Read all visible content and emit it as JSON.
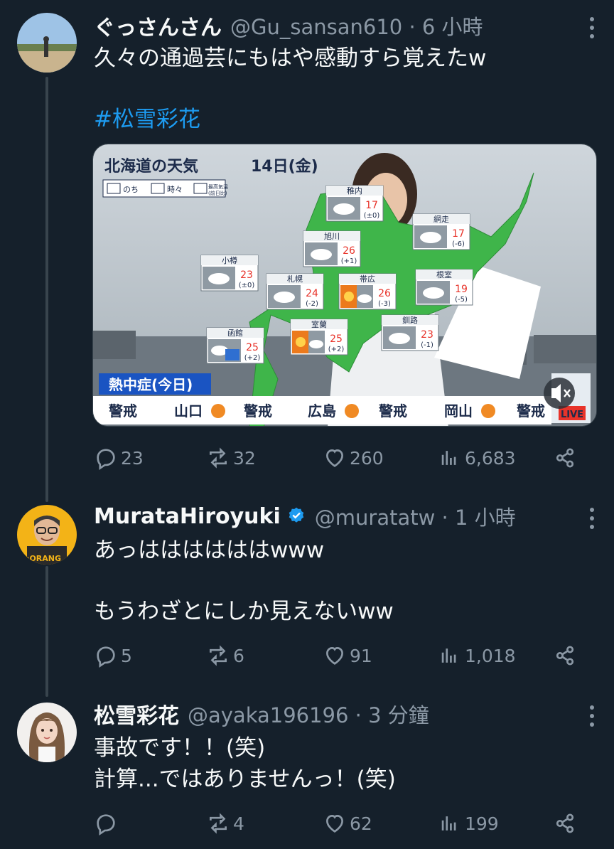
{
  "tweets": [
    {
      "name": "ぐっさんさん",
      "handle": "@Gu_sansan610 · 6 小時",
      "lines": [
        "久々の通過芸にもはや感動すら覚えたw",
        "",
        "#松雪彩花"
      ],
      "reply_count": "23",
      "retweet_count": "32",
      "like_count": "260",
      "view_count": "6,683"
    },
    {
      "name": "MurataHiroyuki",
      "handle": "@muratatw · 1 小時",
      "lines": [
        "あっははははははwww",
        "",
        "もうわざとにしか見えないww"
      ],
      "avatar_text": "eORANG",
      "reply_count": "5",
      "retweet_count": "6",
      "like_count": "91",
      "view_count": "1,018"
    },
    {
      "name": "松雪彩花",
      "handle": "@ayaka196196 · 3 分鐘",
      "lines": [
        "事故です！！(笑)",
        "計算...ではありませんっ！(笑)"
      ],
      "reply_count": "",
      "retweet_count": "4",
      "like_count": "62",
      "view_count": "199"
    }
  ],
  "weather": {
    "title": "北海道の天気",
    "date": "14日(金)",
    "legend_nochi": "のち",
    "legend_tokidoki": "時々",
    "legend_max_temp": "最高気温",
    "legend_vs_prev": "(前日比)",
    "heat_label": "熱中症(今日)",
    "ticker": [
      "警戒",
      "山口",
      "警戒",
      "広島",
      "警戒",
      "岡山",
      "警戒"
    ],
    "live_text": "LIVE",
    "cities": [
      {
        "name": "稚内",
        "temp": "17",
        "diff": "(±0)"
      },
      {
        "name": "網走",
        "temp": "17",
        "diff": "(-6)"
      },
      {
        "name": "旭川",
        "temp": "26",
        "diff": "(+1)"
      },
      {
        "name": "小樽",
        "temp": "23",
        "diff": "(±0)"
      },
      {
        "name": "札幌",
        "temp": "24",
        "diff": "(-2)"
      },
      {
        "name": "帯広",
        "temp": "26",
        "diff": "(-3)"
      },
      {
        "name": "根室",
        "temp": "19",
        "diff": "(-5)"
      },
      {
        "name": "函館",
        "temp": "25",
        "diff": "(+2)"
      },
      {
        "name": "室蘭",
        "temp": "25",
        "diff": "(+2)"
      },
      {
        "name": "釧路",
        "temp": "23",
        "diff": "(-1)"
      }
    ]
  },
  "colors": {
    "background": "#15202b",
    "text_secondary": "#8b98a5",
    "hashtag": "#1d9bf0",
    "map_green": "#3fb54a",
    "temp_red": "#e8332a"
  }
}
